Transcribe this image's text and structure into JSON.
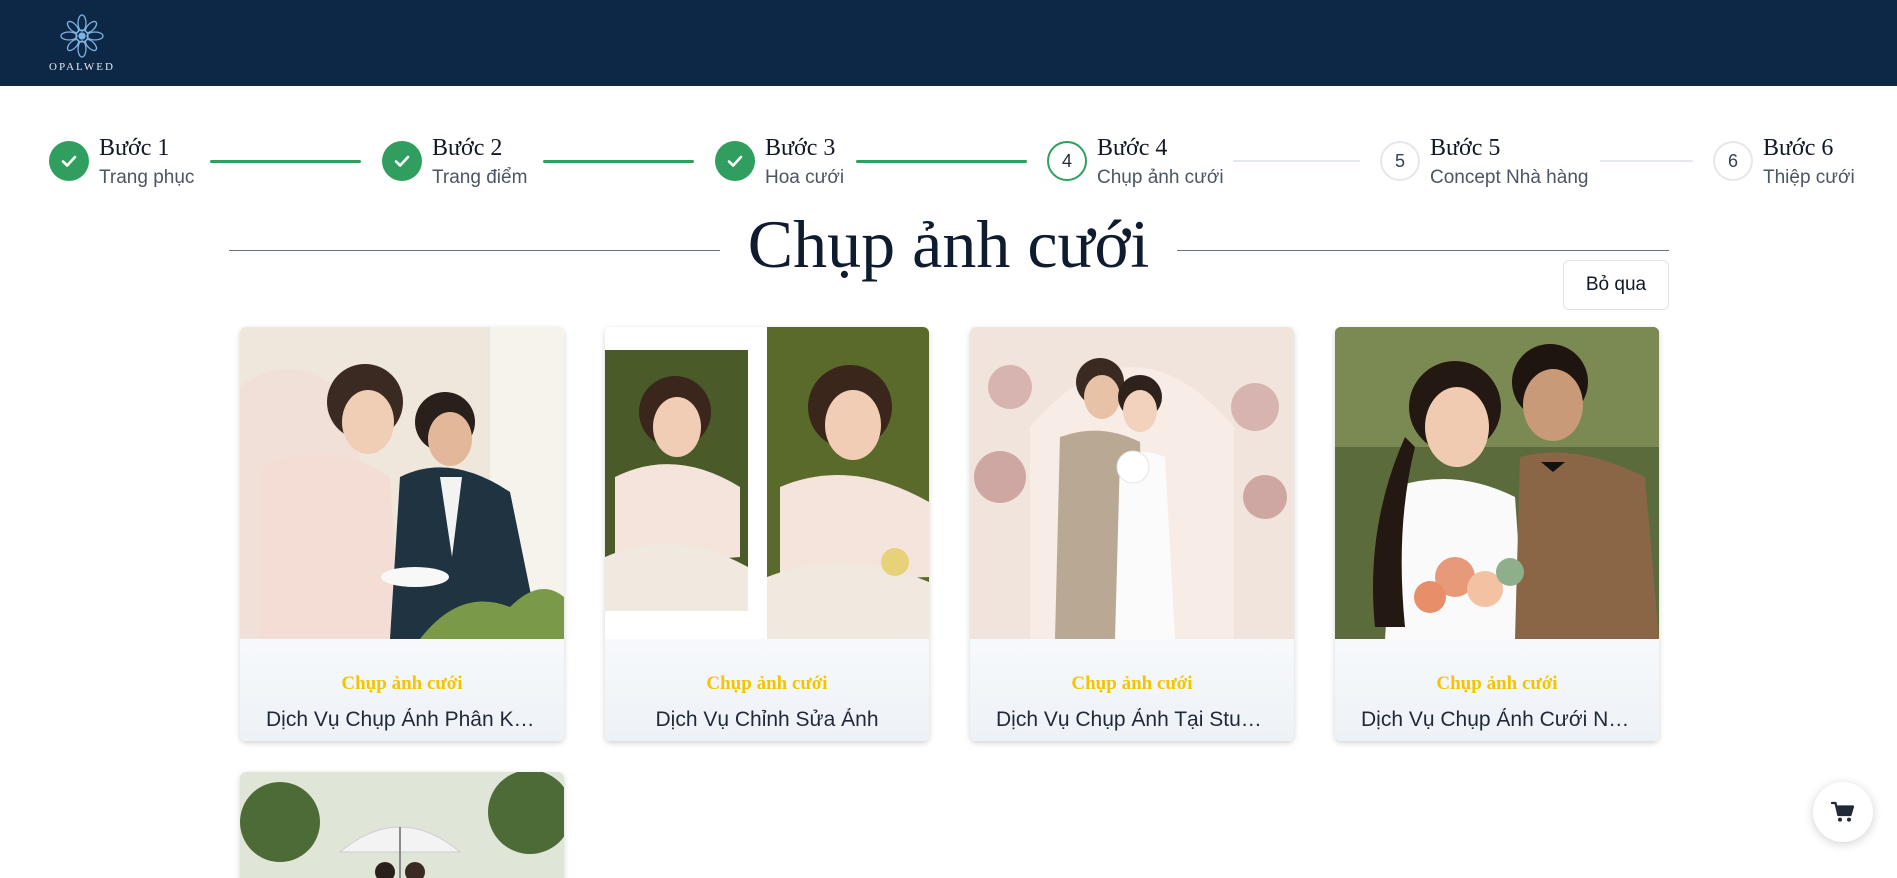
{
  "header": {
    "logo_text": "OPALWED",
    "background": "#0d2847"
  },
  "stepper": {
    "accent": "#2f9e5e",
    "steps": [
      {
        "number": "1",
        "title": "Bước 1",
        "subtitle": "Trang phục",
        "status": "done"
      },
      {
        "number": "2",
        "title": "Bước 2",
        "subtitle": "Trang điểm",
        "status": "done"
      },
      {
        "number": "3",
        "title": "Bước 3",
        "subtitle": "Hoa cưới",
        "status": "done"
      },
      {
        "number": "4",
        "title": "Bước 4",
        "subtitle": "Chụp ảnh cưới",
        "status": "active"
      },
      {
        "number": "5",
        "title": "Bước 5",
        "subtitle": "Concept Nhà hàng",
        "status": "todo"
      },
      {
        "number": "6",
        "title": "Bước 6",
        "subtitle": "Thiệp cưới",
        "status": "todo"
      }
    ]
  },
  "main": {
    "title": "Chụp ảnh cưới",
    "skip_label": "Bỏ qua",
    "cards": [
      {
        "category": "Chụp ảnh cưới",
        "name": "Dịch Vụ Chụp Ảnh Phân Khúc Cao Cấp"
      },
      {
        "category": "Chụp ảnh cưới",
        "name": "Dịch Vụ Chỉnh Sửa Ảnh"
      },
      {
        "category": "Chụp ảnh cưới",
        "name": "Dịch Vụ Chụp Ảnh Tại Studio"
      },
      {
        "category": "Chụp ảnh cưới",
        "name": "Dịch Vụ Chụp Ảnh Cưới Ngoại Cảnh"
      }
    ],
    "category_color": "#f5c400"
  },
  "cart": {
    "icon": "cart-icon"
  }
}
